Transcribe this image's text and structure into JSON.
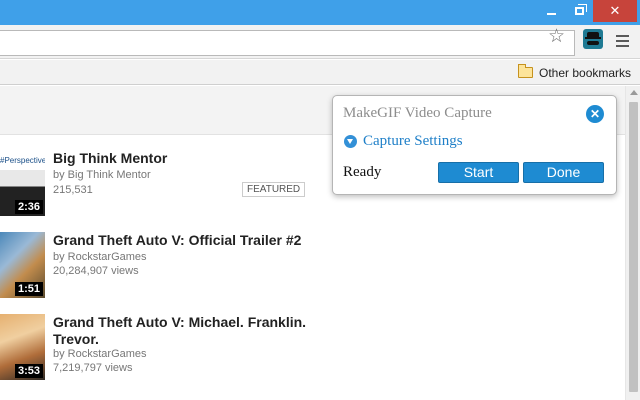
{
  "window": {
    "minimize_glyph": "",
    "close_glyph": "✕"
  },
  "toolbar": {
    "star_glyph": "☆",
    "extension_icon": "makegif-spy-icon",
    "menu_icon": "hamburger-menu-icon"
  },
  "bookmarks": {
    "other_label": "Other bookmarks"
  },
  "videos": [
    {
      "title": "Big Think Mentor",
      "channel": "by Big Think Mentor",
      "views": "215,531",
      "badge": "FEATURED",
      "duration": "2:36",
      "thumb_text": "#Perspective"
    },
    {
      "title": "Grand Theft Auto V: Official Trailer #2",
      "channel": "by RockstarGames",
      "views": "20,284,907 views",
      "duration": "1:51"
    },
    {
      "title": "Grand Theft Auto V: Michael. Franklin. Trevor.",
      "channel": "by RockstarGames",
      "views": "7,219,797 views",
      "duration": "3:53"
    }
  ],
  "popup": {
    "title": "MakeGIF Video Capture",
    "close_glyph": "✕",
    "settings_label": "Capture Settings",
    "status": "Ready",
    "start_label": "Start",
    "done_label": "Done"
  },
  "colors": {
    "titlebar": "#3fa0e9",
    "close": "#c7443b",
    "accent": "#1e8bd2"
  }
}
